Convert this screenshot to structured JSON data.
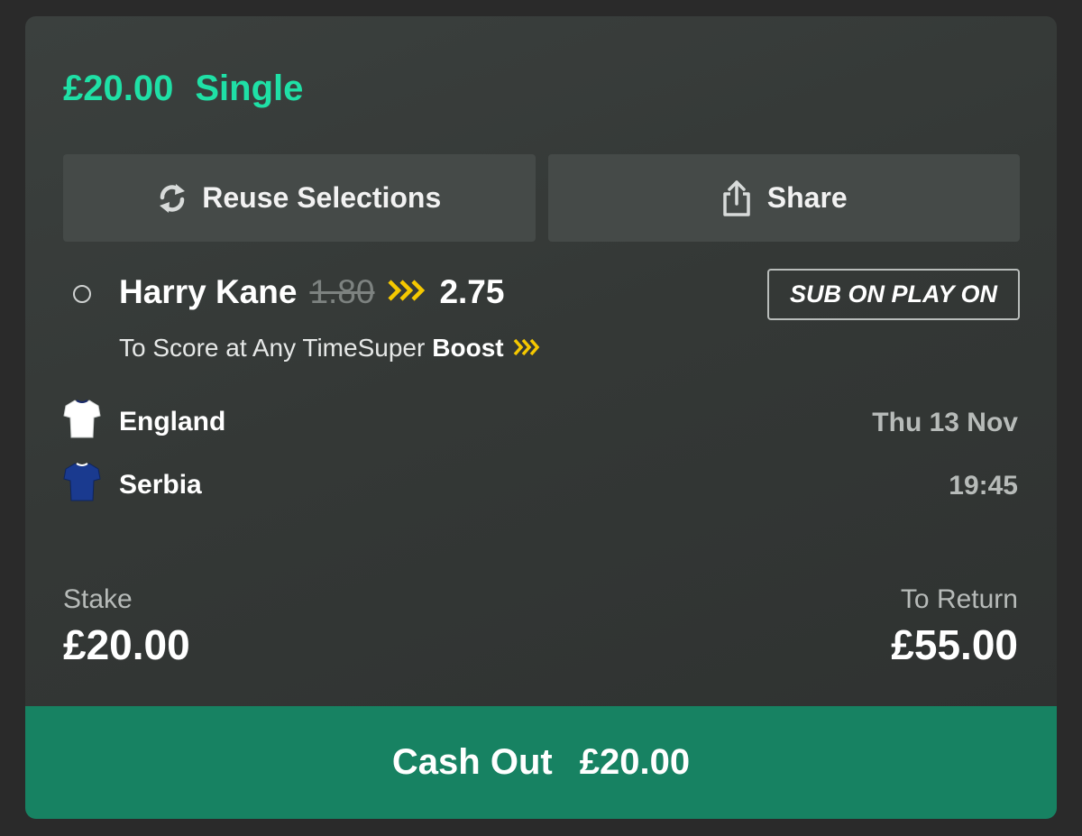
{
  "bet": {
    "stake_display": "£20.00",
    "bet_type": "Single"
  },
  "actions": {
    "reuse_label": "Reuse Selections",
    "reuse_icon": "refresh-icon",
    "share_label": "Share",
    "share_icon": "share-icon"
  },
  "selection": {
    "name": "Harry Kane",
    "original_odds": "1.80",
    "boosted_odds": "2.75",
    "badge": "SUB ON PLAY ON",
    "market": "To Score at Any Time",
    "boost_prefix": "Super",
    "boost_word": "Boost"
  },
  "match": {
    "home_team": "England",
    "away_team": "Serbia",
    "date": "Thu 13 Nov",
    "time": "19:45",
    "home_kit_color": "#ffffff",
    "away_kit_color": "#1a3a8f"
  },
  "summary": {
    "stake_label": "Stake",
    "stake_value": "£20.00",
    "return_label": "To Return",
    "return_value": "£55.00"
  },
  "cashout": {
    "label": "Cash Out",
    "amount": "£20.00"
  },
  "colors": {
    "accent_green": "#1fe0a6",
    "cashout_green": "#178262",
    "boost_yellow": "#f5c800"
  }
}
